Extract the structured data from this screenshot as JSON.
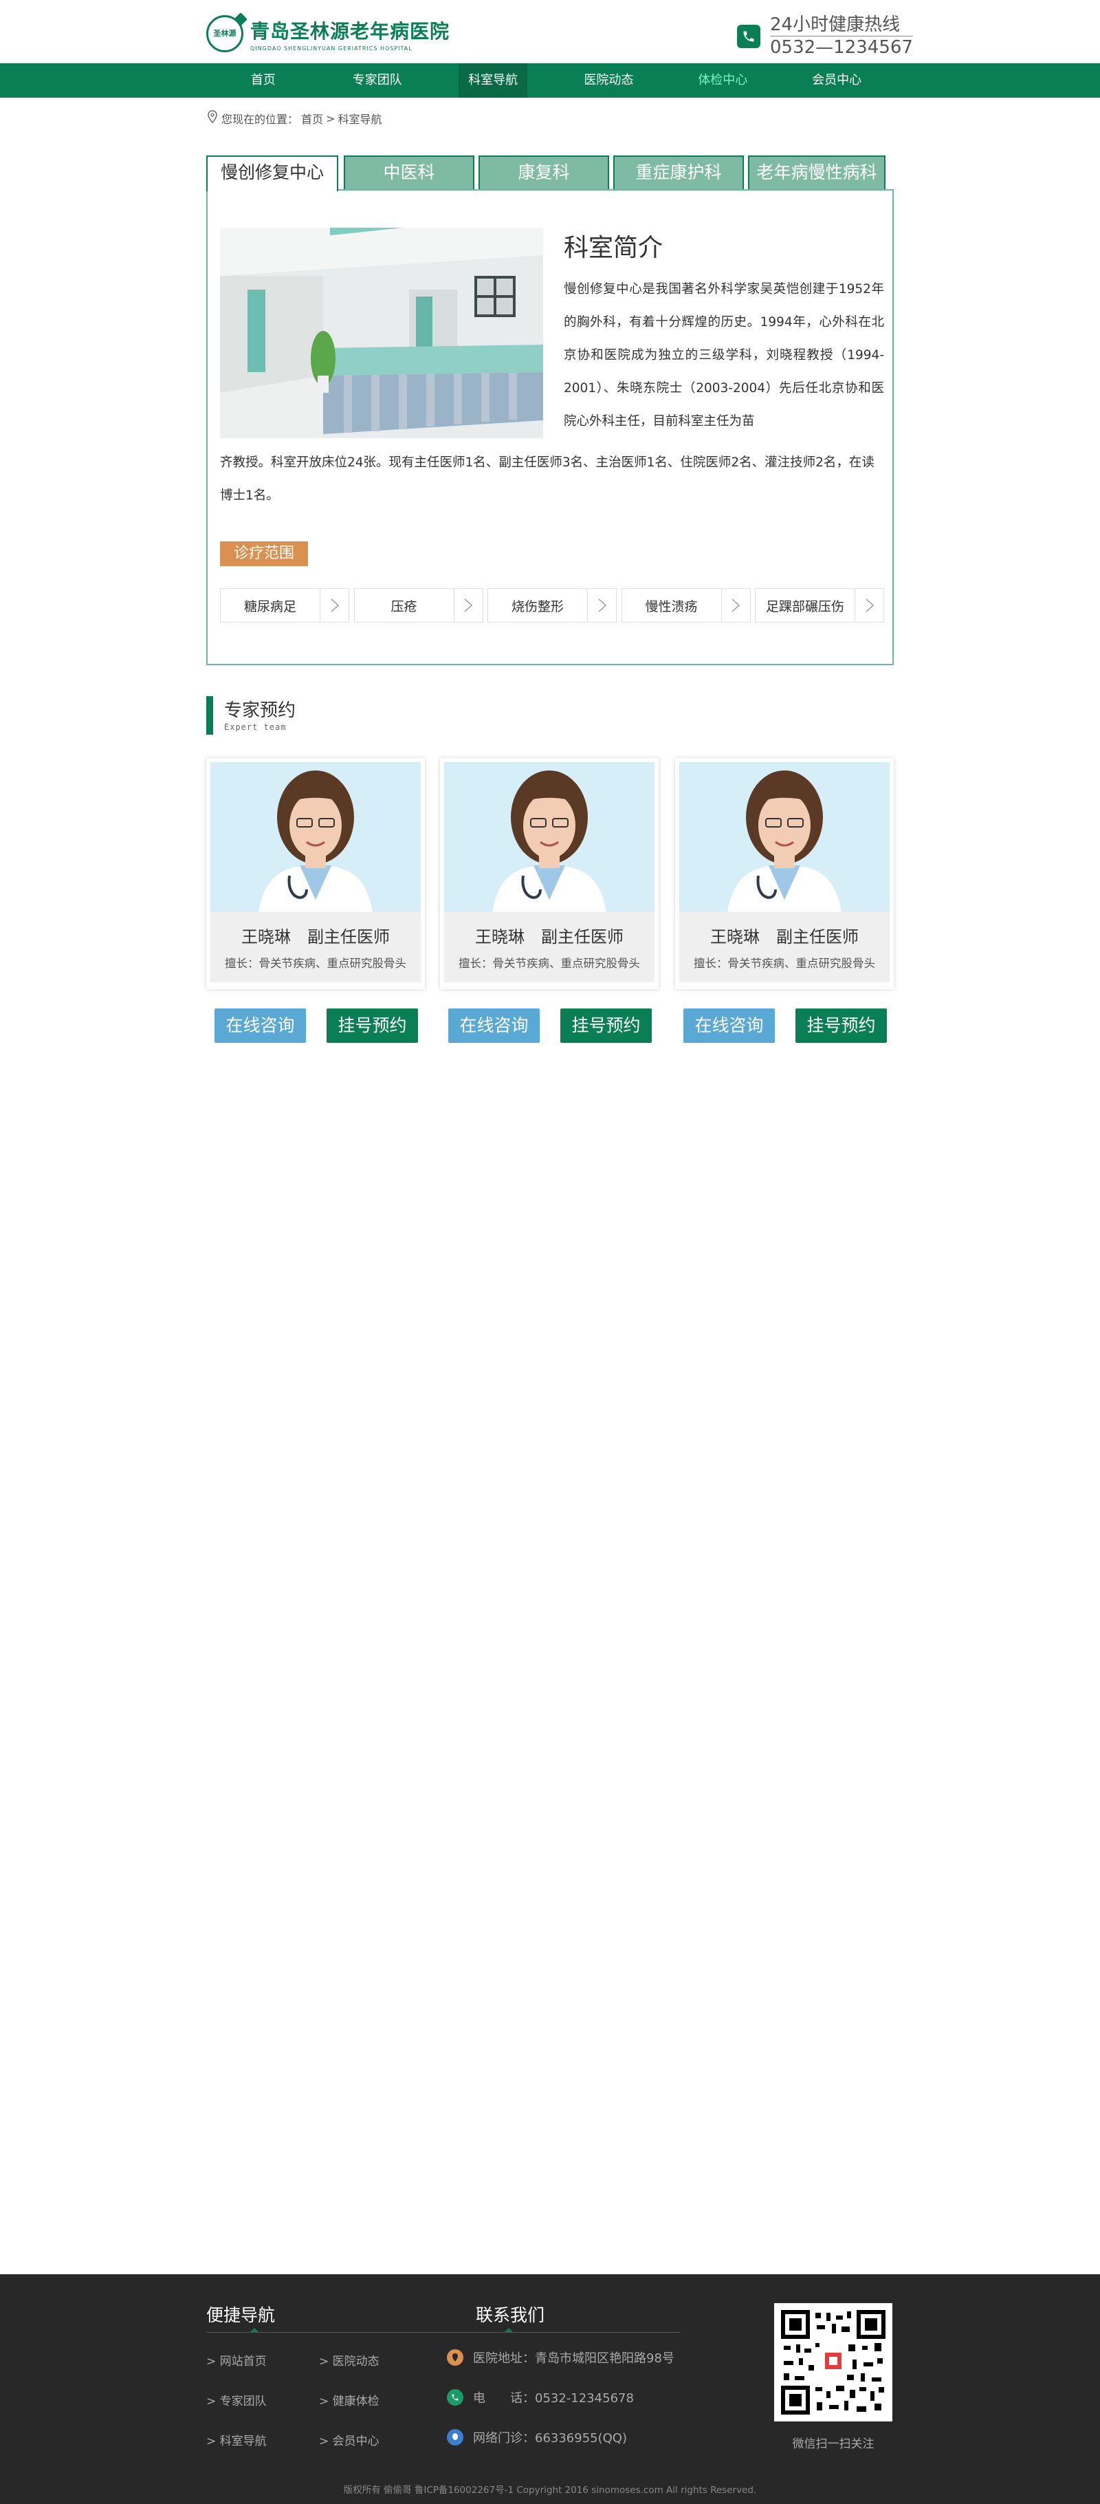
{
  "header": {
    "logo_cn": "青岛圣林源老年病医院",
    "logo_en": "QINGDAO SHENGLINYUAN GERIATRICS HOSPITAL",
    "logo_mark": "圣林源",
    "hotline_label": "24小时健康热线",
    "hotline_number": "0532—1234567"
  },
  "nav": {
    "items": [
      {
        "label": "首页"
      },
      {
        "label": "专家团队"
      },
      {
        "label": "科室导航"
      },
      {
        "label": "医院动态"
      },
      {
        "label": "体检中心"
      },
      {
        "label": "会员中心"
      }
    ]
  },
  "breadcrumb": {
    "prefix": "您现在的位置：",
    "home": "首页",
    "sep": ">",
    "current": "科室导航"
  },
  "tabs": [
    {
      "label": "慢创修复中心"
    },
    {
      "label": "中医科"
    },
    {
      "label": "康复科"
    },
    {
      "label": "重症康护科"
    },
    {
      "label": "老年病慢性病科"
    }
  ],
  "department": {
    "title": "科室简介",
    "desc_part1": "慢创修复中心是我国著名外科学家吴英恺创建于1952年的胸外科，有着十分辉煌的历史。1994年，心外科在北京协和医院成为独立的三级学科，刘晓程教授（1994-2001）、朱晓东院士（2003-2004）先后任北京协和医院心外科主任，目前科室主任为苗",
    "desc_part2": "齐教授。科室开放床位24张。现有主任医师1名、副主任医师3名、主治医师1名、住院医师2名、灌注技师2名，在读博士1名。",
    "scope_label": "诊疗范围",
    "scope_items": [
      "糖尿病足",
      "压疮",
      "烧伤整形",
      "慢性溃疡",
      "足踝部碾压伤"
    ]
  },
  "experts": {
    "title": "专家预约",
    "subtitle": "Expert team",
    "doctors": [
      {
        "name": "王晓琳",
        "title": "副主任医师",
        "specialty": "擅长：骨关节疾病、重点研究股骨头",
        "consult": "在线咨询",
        "book": "挂号预约"
      },
      {
        "name": "王晓琳",
        "title": "副主任医师",
        "specialty": "擅长：骨关节疾病、重点研究股骨头",
        "consult": "在线咨询",
        "book": "挂号预约"
      },
      {
        "name": "王晓琳",
        "title": "副主任医师",
        "specialty": "擅长：骨关节疾病、重点研究股骨头",
        "consult": "在线咨询",
        "book": "挂号预约"
      }
    ]
  },
  "footer": {
    "nav_title": "便捷导航",
    "contact_title": "联系我们",
    "links": [
      "> 网站首页",
      "> 医院动态",
      "> 专家团队",
      "> 健康体检",
      "> 科室导航",
      "> 会员中心"
    ],
    "address": "医院地址：青岛市城阳区艳阳路98号",
    "phone": "电　　话：0532-12345678",
    "clinic": "网络门诊：66336955(QQ)",
    "qr_label": "微信扫一扫关注",
    "copyright": "版权所有 偷偷哥 鲁ICP备16002267号-1 Copyright 2016 sinomoses.com All rights Reserved."
  },
  "colors": {
    "brand_green": "#0a7f55",
    "tab_green": "#7fbaa5",
    "scope_orange": "#d99051",
    "consult_blue": "#5aa8d4",
    "footer_bg": "#282828"
  }
}
